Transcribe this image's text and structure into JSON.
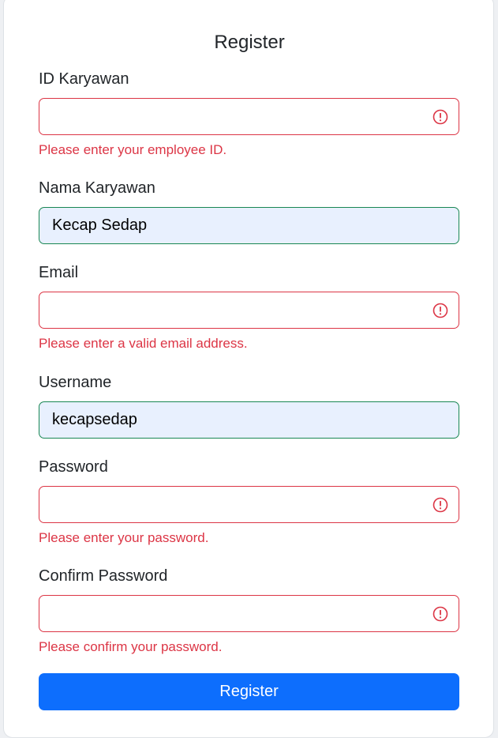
{
  "form": {
    "title": "Register",
    "fields": [
      {
        "label": "ID Karyawan",
        "value": "",
        "state": "invalid",
        "feedback": "Please enter your employee ID."
      },
      {
        "label": "Nama Karyawan",
        "value": "Kecap Sedap",
        "state": "valid",
        "feedback": ""
      },
      {
        "label": "Email",
        "value": "",
        "state": "invalid",
        "feedback": "Please enter a valid email address."
      },
      {
        "label": "Username",
        "value": "kecapsedap",
        "state": "valid",
        "feedback": ""
      },
      {
        "label": "Password",
        "value": "",
        "state": "invalid",
        "feedback": "Please enter your password."
      },
      {
        "label": "Confirm Password",
        "value": "",
        "state": "invalid",
        "feedback": "Please confirm your password."
      }
    ],
    "submit_label": "Register"
  },
  "colors": {
    "invalid": "#dc3545",
    "valid": "#198754",
    "autofill_bg": "#e8f0fe",
    "primary": "#0d6efd"
  },
  "icons": {
    "invalid_field": "exclamation-circle-icon"
  }
}
